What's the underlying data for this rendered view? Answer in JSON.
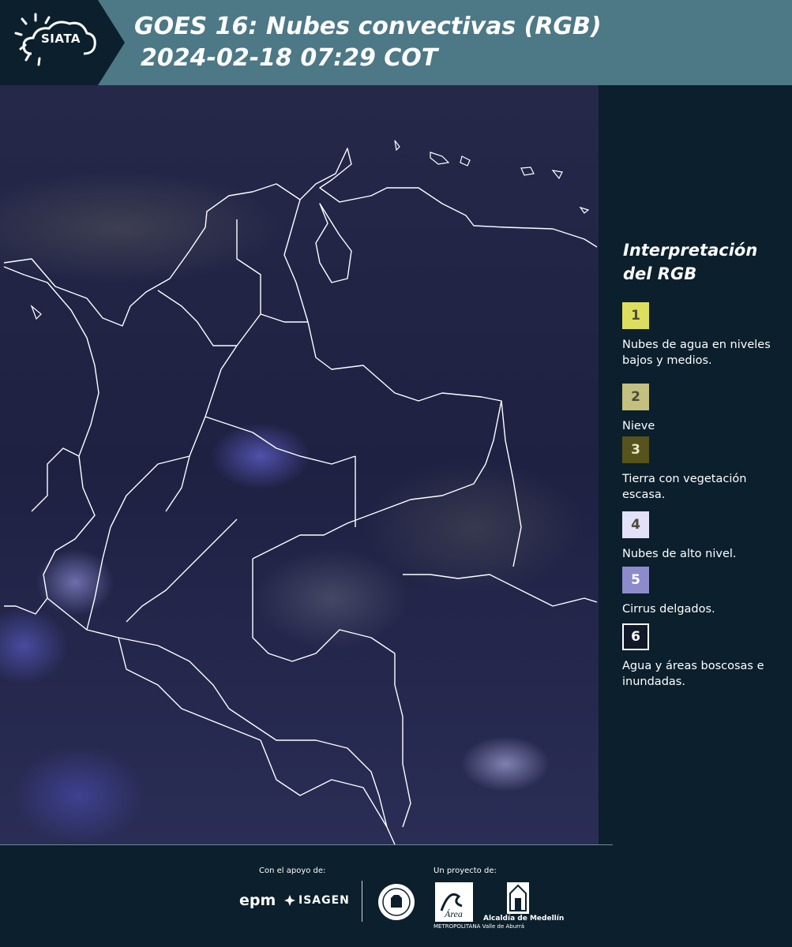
{
  "header": {
    "logo_text": "SIATA",
    "title_line1": "GOES 16: Nubes convectivas (RGB)",
    "title_line2": "2024-02-18 07:29 COT",
    "background_color": "#4d7886",
    "logo_background_color": "#0b1f2c"
  },
  "legend": {
    "title": "Interpretación del RGB",
    "items": [
      {
        "number": "1",
        "color": "#dede5e",
        "label": "Nubes de agua en niveles bajos y medios."
      },
      {
        "number": "2",
        "color": "#c3c080",
        "label": "Nieve"
      },
      {
        "number": "3",
        "color": "#56531c",
        "label": "Tierra con vegetación escasa."
      },
      {
        "number": "4",
        "color": "#e2e1f7",
        "label": "Nubes de alto nivel."
      },
      {
        "number": "5",
        "color": "#8d8bcb",
        "label": "Cirrus delgados."
      },
      {
        "number": "6",
        "color": "#111827",
        "label": "Agua y áreas boscosas e inundadas."
      }
    ]
  },
  "footer": {
    "support_label": "Con el apoyo de:",
    "project_label": "Un proyecto de:",
    "sponsors": [
      "epm",
      "ISAGEN"
    ],
    "partner_area_name": "Área",
    "partner_area_subtitle": "METROPOLITANA Valle de Aburrá",
    "partner_alcaldia": "Alcaldía de Medellín"
  }
}
